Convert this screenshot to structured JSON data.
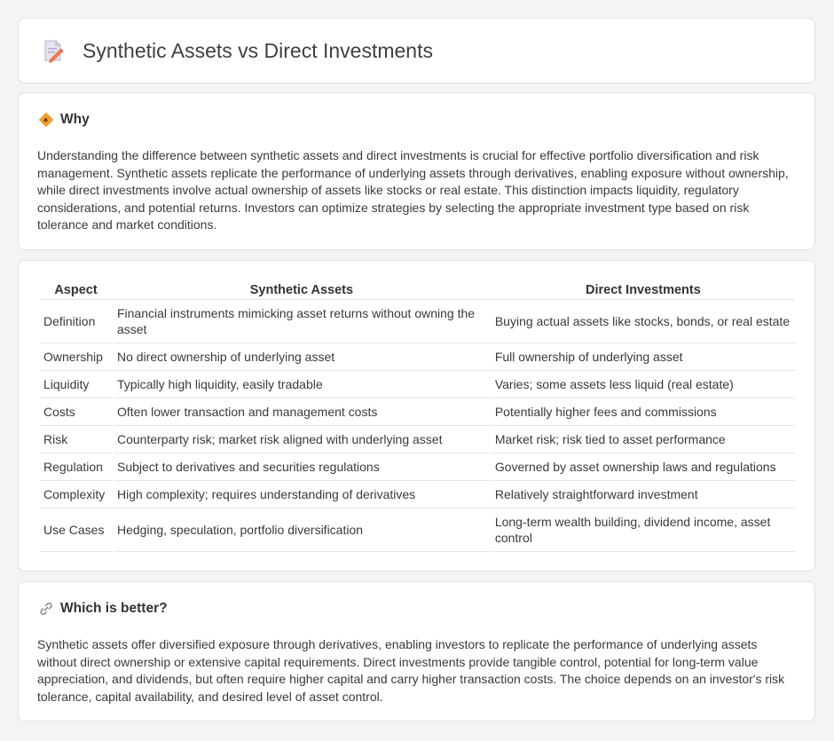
{
  "header": {
    "title": "Synthetic Assets vs Direct Investments",
    "icon": "document-pencil-icon"
  },
  "why": {
    "title": "Why",
    "icon": "diamond-sign-icon",
    "text": "Understanding the difference between synthetic assets and direct investments is crucial for effective portfolio diversification and risk management. Synthetic assets replicate the performance of underlying assets through derivatives, enabling exposure without ownership, while direct investments involve actual ownership of assets like stocks or real estate. This distinction impacts liquidity, regulatory considerations, and potential returns. Investors can optimize strategies by selecting the appropriate investment type based on risk tolerance and market conditions."
  },
  "table": {
    "headers": [
      "Aspect",
      "Synthetic Assets",
      "Direct Investments"
    ],
    "rows": [
      [
        "Definition",
        "Financial instruments mimicking asset returns without owning the asset",
        "Buying actual assets like stocks, bonds, or real estate"
      ],
      [
        "Ownership",
        "No direct ownership of underlying asset",
        "Full ownership of underlying asset"
      ],
      [
        "Liquidity",
        "Typically high liquidity, easily tradable",
        "Varies; some assets less liquid (real estate)"
      ],
      [
        "Costs",
        "Often lower transaction and management costs",
        "Potentially higher fees and commissions"
      ],
      [
        "Risk",
        "Counterparty risk; market risk aligned with underlying asset",
        "Market risk; risk tied to asset performance"
      ],
      [
        "Regulation",
        "Subject to derivatives and securities regulations",
        "Governed by asset ownership laws and regulations"
      ],
      [
        "Complexity",
        "High complexity; requires understanding of derivatives",
        "Relatively straightforward investment"
      ],
      [
        "Use Cases",
        "Hedging, speculation, portfolio diversification",
        "Long-term wealth building, dividend income, asset control"
      ]
    ]
  },
  "better": {
    "title": "Which is better?",
    "icon": "link-icon",
    "text": "Synthetic assets offer diversified exposure through derivatives, enabling investors to replicate the performance of underlying assets without direct ownership or extensive capital requirements. Direct investments provide tangible control, potential for long-term value appreciation, and dividends, but often require higher capital and carry higher transaction costs. The choice depends on an investor's risk tolerance, capital availability, and desired level of asset control."
  },
  "colors": {
    "background": "#f4f4f6",
    "card": "#ffffff",
    "border": "#e2e2e6",
    "accent_orange": "#f0a030"
  }
}
